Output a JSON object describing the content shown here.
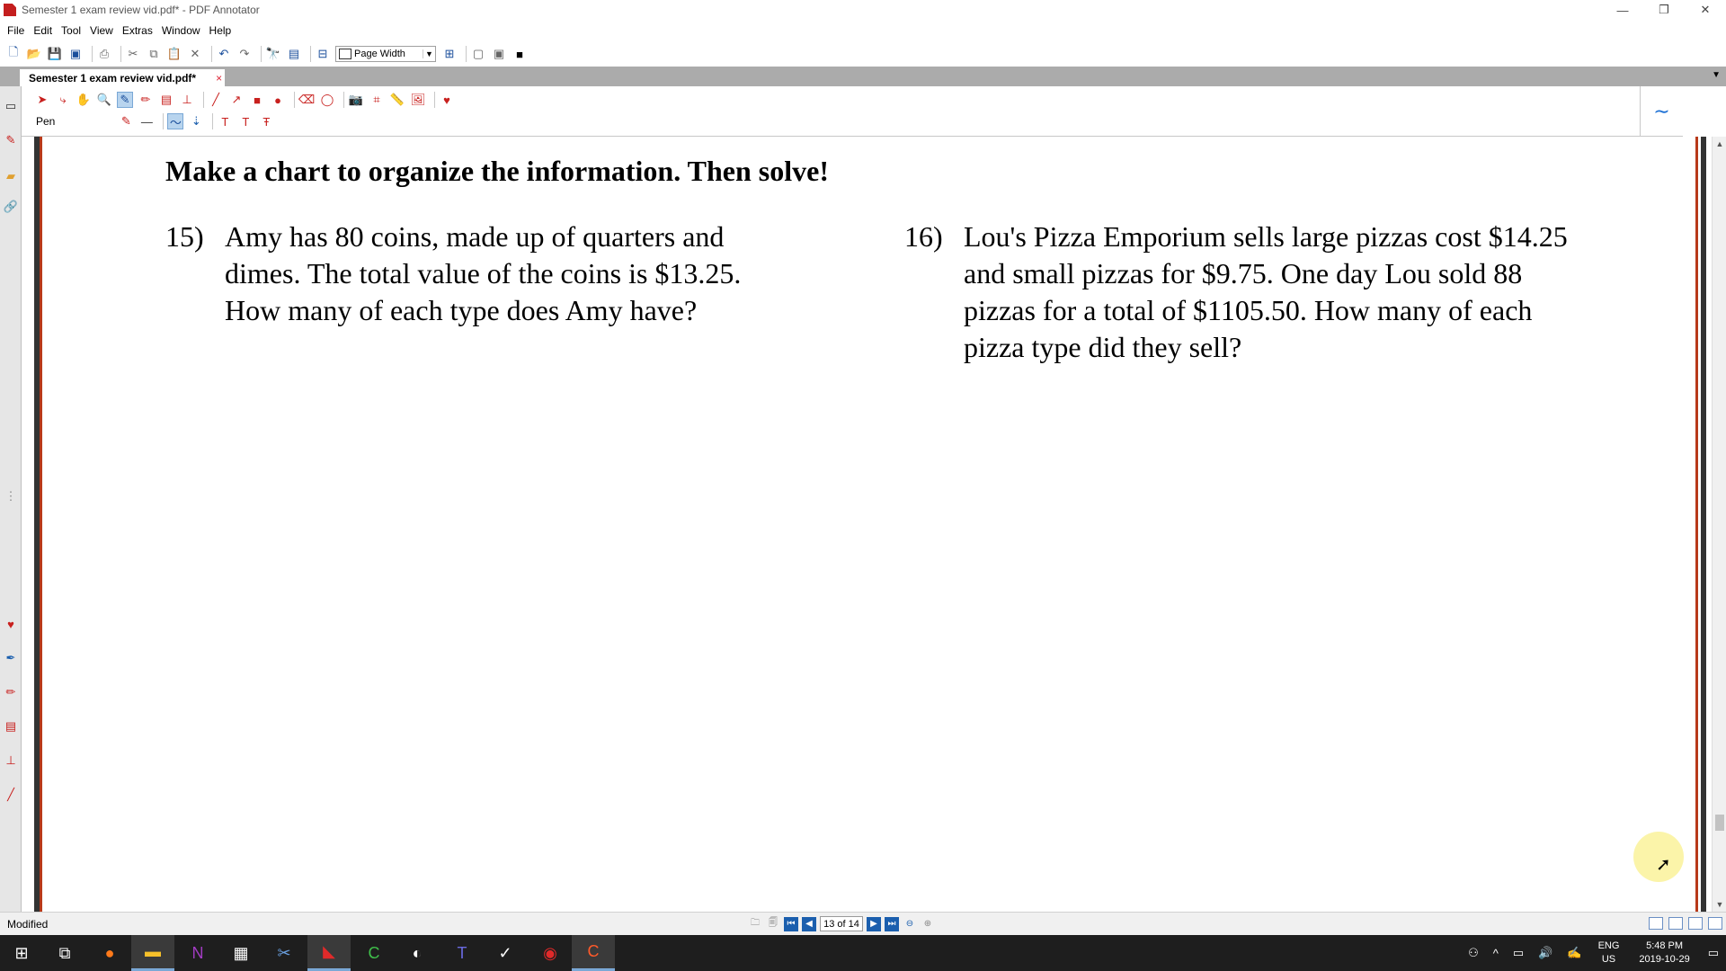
{
  "window": {
    "title": "Semester 1 exam review vid.pdf* - PDF Annotator",
    "minimize": "—",
    "restore": "❐",
    "close": "✕"
  },
  "menu": [
    "File",
    "Edit",
    "Tool",
    "View",
    "Extras",
    "Window",
    "Help"
  ],
  "toolbar": {
    "zoom_value": "Page Width"
  },
  "tab": {
    "label": "Semester 1 exam review vid.pdf*",
    "close": "×"
  },
  "annotation_toolbar": {
    "current_tool": "Pen"
  },
  "document": {
    "heading": "Make a chart to organize the information. Then solve!",
    "problems": [
      {
        "number": "15)",
        "text": "Amy has 80 coins, made up of quarters and dimes. The total value of the coins is $13.25. How many of each type does Amy have?"
      },
      {
        "number": "16)",
        "text": "Lou's Pizza Emporium sells large pizzas cost $14.25 and small pizzas for $9.75. One day Lou sold 88 pizzas for a total of $1105.50. How many of each pizza type did they sell?"
      }
    ]
  },
  "status": {
    "text": "Modified",
    "page_indicator": "13 of 14"
  },
  "taskbar": {
    "language": "ENG",
    "region": "US",
    "time": "5:48 PM",
    "date": "2019-10-29"
  },
  "colors": {
    "accent_red": "#c8201e",
    "accent_blue": "#1b5fae",
    "taskbar_bg": "#1e1e1e"
  }
}
